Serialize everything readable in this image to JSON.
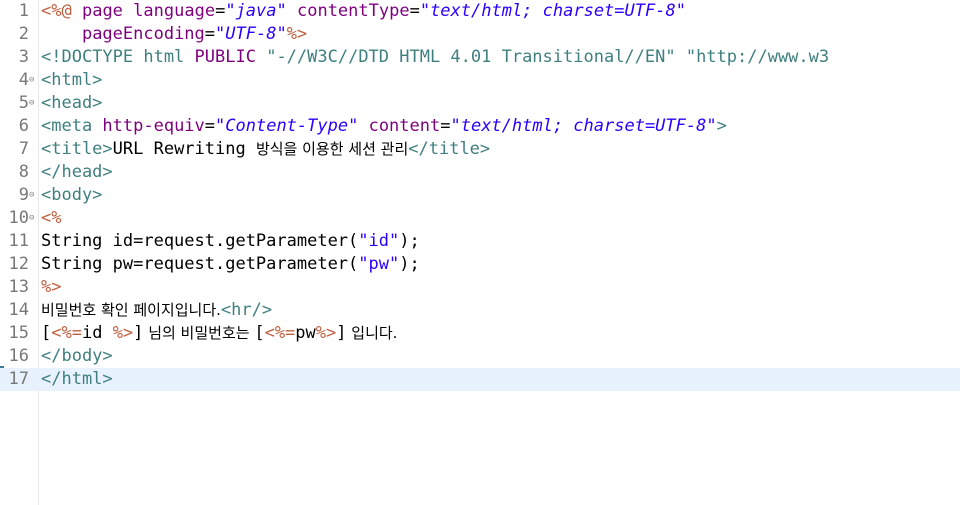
{
  "editor": {
    "lines": [
      {
        "n": "1",
        "segs": [
          [
            "jsp",
            "<%@"
          ],
          [
            "txt",
            " "
          ],
          [
            "attr",
            "page"
          ],
          [
            "txt",
            " "
          ],
          [
            "attr",
            "language"
          ],
          [
            "txt",
            "="
          ],
          [
            "str",
            "\"java\""
          ],
          [
            "txt",
            " "
          ],
          [
            "attr",
            "contentType"
          ],
          [
            "txt",
            "="
          ],
          [
            "str",
            "\"text/html; charset=UTF-8\""
          ]
        ]
      },
      {
        "n": "2",
        "segs": [
          [
            "txt",
            "    "
          ],
          [
            "attr",
            "pageEncoding"
          ],
          [
            "txt",
            "="
          ],
          [
            "str",
            "\"UTF-8\""
          ],
          [
            "jsp",
            "%>"
          ]
        ]
      },
      {
        "n": "3",
        "segs": [
          [
            "tag",
            "<!DOCTYPE html "
          ],
          [
            "attr",
            "PUBLIC"
          ],
          [
            "txt",
            " "
          ],
          [
            "tag",
            "\"-//W3C//DTD HTML 4.01 Transitional//EN\" \"http://www.w3"
          ]
        ]
      },
      {
        "n": "4",
        "fold": "⊖",
        "segs": [
          [
            "tag",
            "<html>"
          ]
        ]
      },
      {
        "n": "5",
        "fold": "⊖",
        "segs": [
          [
            "tag",
            "<head>"
          ]
        ]
      },
      {
        "n": "6",
        "segs": [
          [
            "tag",
            "<meta "
          ],
          [
            "attr",
            "http-equiv"
          ],
          [
            "txt",
            "="
          ],
          [
            "str",
            "\"Content-Type\""
          ],
          [
            "txt",
            " "
          ],
          [
            "attr",
            "content"
          ],
          [
            "txt",
            "="
          ],
          [
            "str",
            "\"text/html; charset=UTF-8\""
          ],
          [
            "tag",
            ">"
          ]
        ]
      },
      {
        "n": "7",
        "segs": [
          [
            "tag",
            "<title>"
          ],
          [
            "txt",
            "URL Rewriting "
          ],
          [
            "ko",
            "방식을 이용한 세션 관리"
          ],
          [
            "tag",
            "</title>"
          ]
        ]
      },
      {
        "n": "8",
        "segs": [
          [
            "tag",
            "</head>"
          ]
        ]
      },
      {
        "n": "9",
        "fold": "⊖",
        "segs": [
          [
            "tag",
            "<body>"
          ]
        ]
      },
      {
        "n": "10",
        "fold": "⊖",
        "segs": [
          [
            "jsp",
            "<%"
          ]
        ]
      },
      {
        "n": "11",
        "segs": [
          [
            "txt",
            "String id=request.getParameter("
          ],
          [
            "jstr",
            "\"id\""
          ],
          [
            "txt",
            ");"
          ]
        ]
      },
      {
        "n": "12",
        "segs": [
          [
            "txt",
            "String pw=request.getParameter("
          ],
          [
            "jstr",
            "\"pw\""
          ],
          [
            "txt",
            ");"
          ]
        ]
      },
      {
        "n": "13",
        "segs": [
          [
            "jsp",
            "%>"
          ]
        ]
      },
      {
        "n": "14",
        "segs": [
          [
            "ko",
            "비밀번호 확인 페이지입니다."
          ],
          [
            "tag",
            "<hr/>"
          ]
        ]
      },
      {
        "n": "15",
        "segs": [
          [
            "txt",
            "["
          ],
          [
            "jsp",
            "<%="
          ],
          [
            "txt",
            "id "
          ],
          [
            "jsp",
            "%>"
          ],
          [
            "txt",
            "]"
          ],
          [
            "ko",
            " 님의 비밀번호는 "
          ],
          [
            "txt",
            "["
          ],
          [
            "jsp",
            "<%="
          ],
          [
            "txt",
            "pw"
          ],
          [
            "jsp",
            "%>"
          ],
          [
            "txt",
            "]"
          ],
          [
            "ko",
            " 입니다."
          ]
        ]
      },
      {
        "n": "16",
        "segs": [
          [
            "tag",
            "</body>"
          ]
        ]
      },
      {
        "n": "17",
        "current": true,
        "segs": [
          [
            "tag",
            "</html>"
          ]
        ]
      }
    ]
  }
}
